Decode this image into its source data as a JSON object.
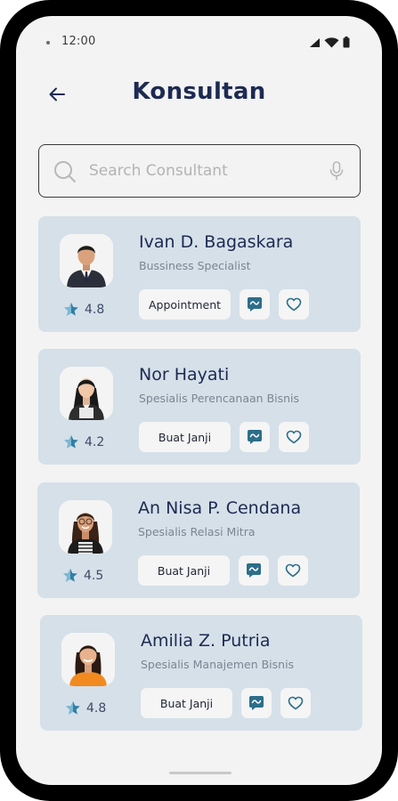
{
  "status_bar": {
    "time": "12:00"
  },
  "header": {
    "title": "Konsultan"
  },
  "search": {
    "placeholder": "Search Consultant"
  },
  "colors": {
    "title": "#1d2a52",
    "card_bg": "#d5e0e9",
    "accent": "#2c6e8a",
    "star": "#2f7fa4"
  },
  "icons": {
    "back": "arrow-left-icon",
    "search": "search-icon",
    "mic": "microphone-icon",
    "star": "star-icon",
    "chat": "chat-icon",
    "favorite": "heart-icon"
  },
  "consultants": [
    {
      "name": "Ivan D. Bagaskara",
      "role": "Bussiness Specialist",
      "rating": "4.8",
      "action_label": "Appointment"
    },
    {
      "name": "Nor Hayati",
      "role": "Spesialis Perencanaan Bisnis",
      "rating": "4.2",
      "action_label": "Buat Janji"
    },
    {
      "name": "An Nisa P. Cendana",
      "role": "Spesialis Relasi Mitra",
      "rating": "4.5",
      "action_label": "Buat Janji"
    },
    {
      "name": "Amilia Z. Putria",
      "role": "Spesialis Manajemen Bisnis",
      "rating": "4.8",
      "action_label": "Buat Janji"
    }
  ]
}
